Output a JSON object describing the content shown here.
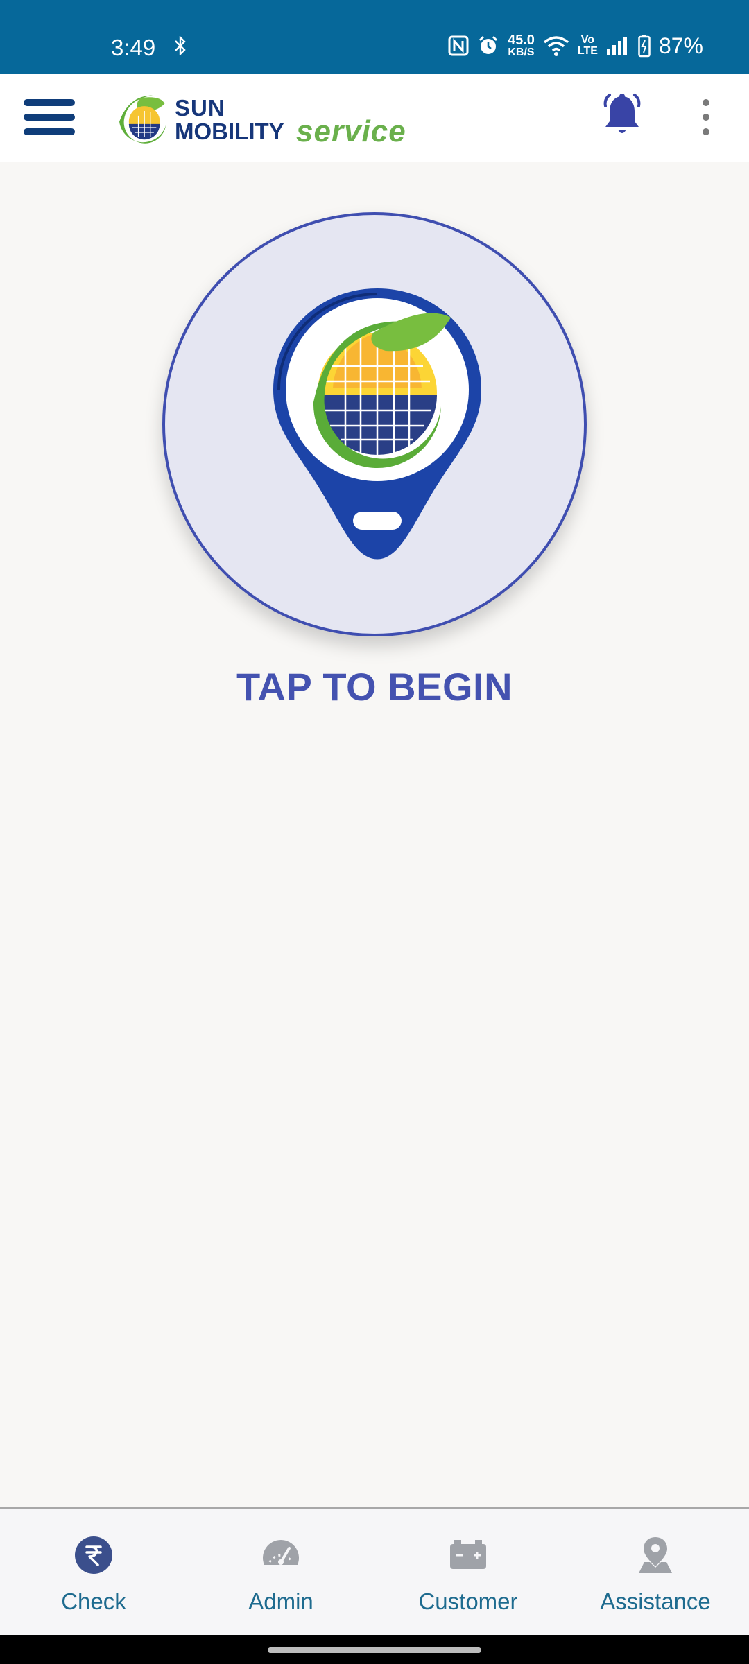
{
  "status_bar": {
    "time": "3:49",
    "speed_value": "45.0",
    "speed_unit": "KB/S",
    "volte_top": "Vo",
    "volte_bottom": "LTE",
    "battery": "87%"
  },
  "app_bar": {
    "logo_line1": "SUN",
    "logo_line2": "MOBILITY",
    "logo_line3": "service"
  },
  "main": {
    "tap_label": "TAP TO BEGIN"
  },
  "bottom_nav": {
    "items": [
      {
        "label": "Check",
        "icon": "rupee-coin-icon",
        "active": true
      },
      {
        "label": "Admin",
        "icon": "speedometer-icon",
        "active": false
      },
      {
        "label": "Customer",
        "icon": "battery-icon",
        "active": false
      },
      {
        "label": "Assistance",
        "icon": "location-pin-icon",
        "active": false
      }
    ]
  },
  "colors": {
    "status_bar": "#06689a",
    "brand_navy": "#16367a",
    "brand_green": "#6ab04c",
    "accent_indigo": "#4452b0",
    "nav_label": "#1e6b8f"
  }
}
